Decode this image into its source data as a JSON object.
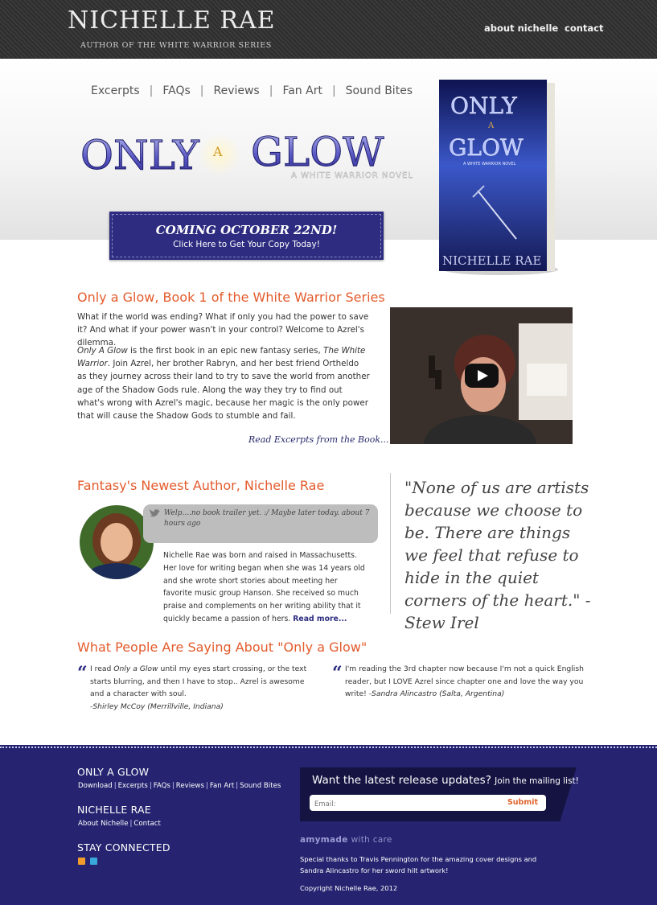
{
  "header": {
    "brand_name": "NICHELLE RAE",
    "brand_subtitle": "AUTHOR OF THE WHITE WARRIOR SERIES",
    "nav": {
      "about": "about nichelle",
      "contact": "contact"
    }
  },
  "subnav": {
    "items": [
      "Excerpts",
      "FAQs",
      "Reviews",
      "Fan Art",
      "Sound Bites"
    ],
    "separator": "|"
  },
  "hero": {
    "logo": {
      "only": "ONLY",
      "a": "A",
      "glow": "GLOW",
      "tagline": "A WHITE WARRIOR NOVEL"
    },
    "cta_title": "COMING OCTOBER 22ND!",
    "cta_subtitle": "Click Here to Get Your Copy Today!",
    "book_cover": {
      "title_top": "ONLY",
      "title_a": "A",
      "title_bottom": "GLOW",
      "series": "A WHITE WARRIOR NOVEL",
      "author": "NICHELLE RAE"
    }
  },
  "intro": {
    "heading": "Only a Glow, Book 1 of the White Warrior Series",
    "paragraph1": "What if the world was ending? What if only you had the power to save it? And what if your power wasn't in your control? Welcome to Azrel's dilemma.",
    "paragraph2_title": "Only A Glow",
    "paragraph2_mid": " is the first book in an epic new fantasy series, ",
    "paragraph2_series": "The White Warrior",
    "paragraph2_rest": ". Join Azrel, her brother Rabryn, and her best friend Ortheldo as they journey across their land to try to save the world from another age of the Shadow Gods rule. Along the way they try to find out what's wrong with Azrel's magic, because her magic is the only power that will cause the Shadow Gods to stumble and fail.",
    "read_link": "Read Excerpts from the Book..."
  },
  "author": {
    "heading": "Fantasy's Newest Author, Nichelle Rae",
    "tweet_text": "Welp....no book trailer yet. :/ Maybe later today.",
    "tweet_time": "about 7 hours ago",
    "bio": "Nichelle Rae was born and raised in Massachusetts. Her love for writing began when she was 14 years old and she wrote short stories about meeting her favorite music group Hanson. She received so much praise and complements on her writing ability that it quickly became a passion of hers.",
    "read_more": "Read more..."
  },
  "quote": {
    "text": "\"None of us are artists because we choose to be. There are things we feel that refuse to hide in the quiet corners of the heart.\" -Stew Irel"
  },
  "testimonials": {
    "heading": "What People Are Saying About \"Only a Glow\"",
    "items": [
      {
        "before": "I read ",
        "title": "Only a Glow",
        "after": " until my eyes start crossing, or the text starts blurring, and then I have to stop.. Azrel is awesome and a character with soul.",
        "author": "-Shirley McCoy (Merrillville, Indiana)"
      },
      {
        "before": "I'm reading the 3rd chapter now because I'm not a quick English reader, but I LOVE Azrel since chapter one and love the way you write! ",
        "author": "-Sandra Alincastro (Salta, Argentina)"
      }
    ]
  },
  "footer": {
    "sections": [
      {
        "heading": "ONLY A GLOW",
        "links": [
          "Download",
          "Excerpts",
          "FAQs",
          "Reviews",
          "Fan Art",
          "Sound Bites"
        ]
      },
      {
        "heading": "NICHELLE RAE",
        "links": [
          "About Nichelle",
          "Contact"
        ]
      },
      {
        "heading": "STAY CONNECTED",
        "icons": [
          "rss-icon",
          "twitter-icon"
        ]
      }
    ],
    "mailing": {
      "title": "Want the latest release updates?",
      "title_small": "Join the mailing list!",
      "placeholder": "Email:",
      "submit": "Submit"
    },
    "amymade": "amymade",
    "amymade_tail": "with care",
    "thanks": "Special thanks to Travis Pennington for the amazing cover designs and Sandra Alincastro for her sword hilt artwork!",
    "copyright": "Copyright Nichelle Rae, 2012"
  },
  "colors": {
    "accent_orange": "#e35b2c",
    "brand_navy": "#2d2c80",
    "footer_bg": "#262470",
    "header_dark": "#333333"
  }
}
